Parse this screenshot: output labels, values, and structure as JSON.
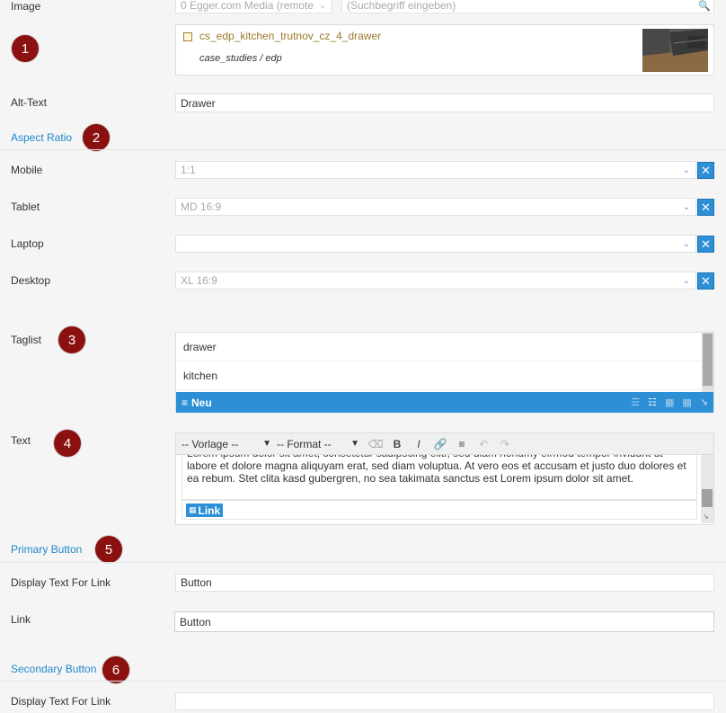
{
  "image_section": {
    "label": "Image",
    "source_select": "0 Egger.com Media (remote",
    "search_placeholder": "(Suchbegriff eingeben)",
    "file_name": "cs_edp_kitchen_trutnov_cz_4_drawer",
    "file_path": "case_studies / edp"
  },
  "alt_text": {
    "label": "Alt-Text",
    "value": "Drawer"
  },
  "aspect_ratio": {
    "title": "Aspect Ratio",
    "rows": [
      {
        "label": "Mobile",
        "value": "1:1"
      },
      {
        "label": "Tablet",
        "value": "MD 16:9"
      },
      {
        "label": "Laptop",
        "value": ""
      },
      {
        "label": "Desktop",
        "value": "XL 16:9"
      }
    ]
  },
  "taglist": {
    "label": "Taglist",
    "items": [
      "drawer",
      "kitchen"
    ],
    "add_label": "Neu"
  },
  "text_field": {
    "label": "Text",
    "template_select": "-- Vorlage --",
    "format_select": "-- Format --",
    "body": "Lorem ipsum dolor sit amet, consetetur sadipscing elitr, sed diam nonumy eirmod tempor invidunt ut labore et dolore magna aliquyam erat, sed diam voluptua. At vero eos et accusam et justo duo dolores et ea rebum. Stet clita kasd gubergren, no sea takimata sanctus est Lorem ipsum dolor sit amet.",
    "link_chip": "Link"
  },
  "primary_button": {
    "title": "Primary Button",
    "display_label": "Display Text For Link",
    "display_value": "Button",
    "link_label": "Link",
    "link_value": "Button"
  },
  "secondary_button": {
    "title": "Secondary Button",
    "display_label": "Display Text For Link",
    "display_value": ""
  },
  "markers": [
    "1",
    "2",
    "3",
    "4",
    "5",
    "6"
  ],
  "colors": {
    "accent": "#2d8fd5",
    "marker": "#8b1010",
    "section_title": "#1e88c8"
  }
}
